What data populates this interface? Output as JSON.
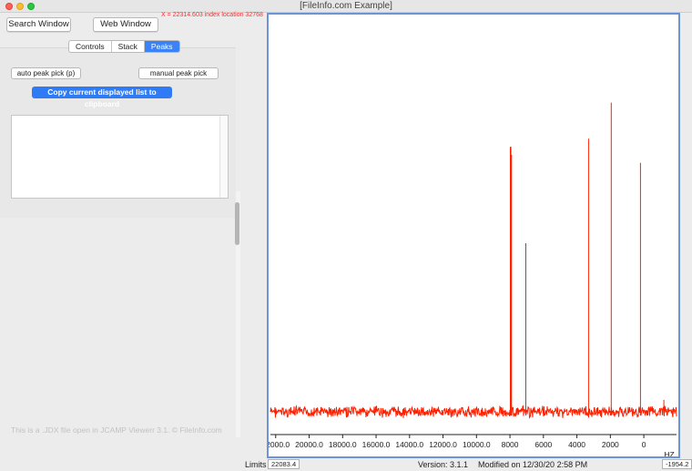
{
  "window": {
    "title": "[FileInfo.com Example]"
  },
  "toolbar": {
    "search_window": "Search Window",
    "web_window": "Web Window",
    "cursor_readout": "X = 22314.603 index location 32768"
  },
  "tabs": [
    {
      "label": "Controls",
      "active": false
    },
    {
      "label": "Stack",
      "active": false
    },
    {
      "label": "Peaks",
      "active": true
    }
  ],
  "peaks_panel": {
    "auto_pick": "auto peak pick (p)",
    "manual_pick": "manual peak pick",
    "copy_list": "Copy current displayed list to clipboard"
  },
  "footer_note": "This is a .JDX file open in JCAMP Viewerr 3.1. © FileInfo.com",
  "colors": {
    "spectrum": "#ff2000",
    "plot_border": "#6b94d9",
    "accent": "#2f7bf5"
  },
  "chart_data": {
    "type": "line",
    "xlabel": "HZ",
    "xlim": [
      22314.6,
      -1954.2
    ],
    "ylim": [
      0,
      100
    ],
    "x_ticks": [
      "22000.0",
      "20000.0",
      "18000.0",
      "16000.0",
      "14000.0",
      "12000.0",
      "10000.0",
      "8000",
      "6000",
      "4000",
      "2000",
      "0"
    ],
    "x_tick_values": [
      22000,
      20000,
      18000,
      16000,
      14000,
      12000,
      10000,
      8000,
      6000,
      4000,
      2000,
      0
    ],
    "baseline": 2,
    "peaks": [
      {
        "x": 7960,
        "y": 68
      },
      {
        "x": 7920,
        "y": 66
      },
      {
        "x": 7050,
        "y": 44
      },
      {
        "x": 3300,
        "y": 70
      },
      {
        "x": 1950,
        "y": 79
      },
      {
        "x": 200,
        "y": 64
      },
      {
        "x": -1200,
        "y": 5
      }
    ],
    "grid": false
  },
  "status": {
    "limits_label": "Limits",
    "limits_value": "22083.4",
    "version": "Version: 3.1.1",
    "modified": "Modified on 12/30/20  2:58 PM",
    "right_value": "-1954.2"
  }
}
